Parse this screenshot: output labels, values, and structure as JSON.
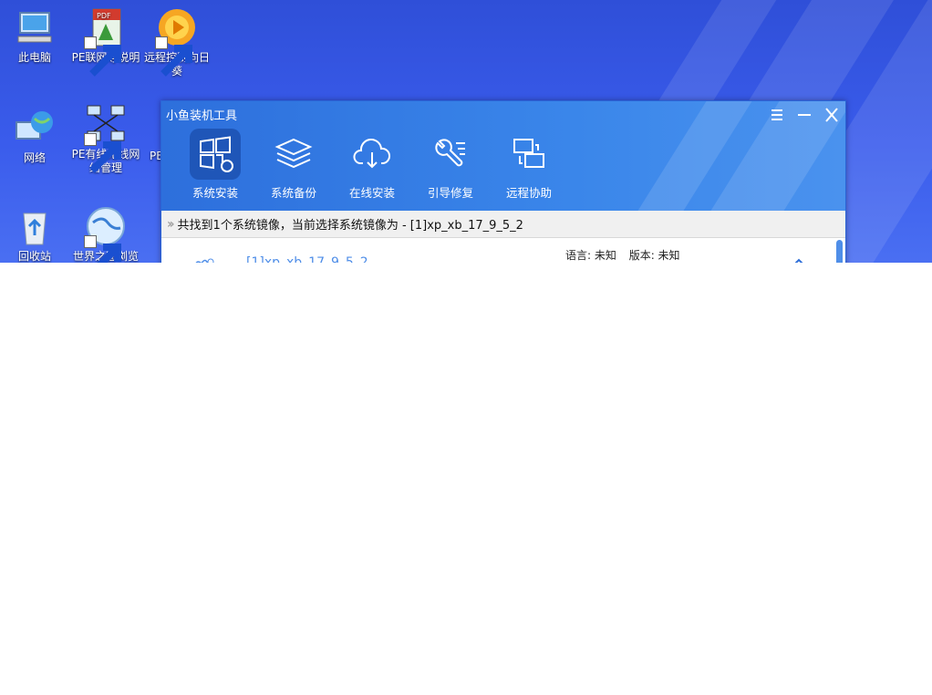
{
  "desktop": {
    "icons": [
      {
        "label": "此电脑",
        "icon": "computer-icon"
      },
      {
        "label": "PE联网等说明",
        "icon": "pdf-document-icon"
      },
      {
        "label": "远程控制向日葵",
        "icon": "sunflower-remote-icon"
      },
      {
        "label": "网络",
        "icon": "network-globe-icon"
      },
      {
        "label": "PE有线无线网络管理",
        "icon": "network-manager-icon"
      },
      {
        "label": "PE",
        "icon": "partial-icon"
      },
      {
        "label": "回收站",
        "icon": "recycle-bin-icon"
      },
      {
        "label": "世界之窗浏览",
        "icon": "browser-globe-icon"
      }
    ]
  },
  "app": {
    "title": "小鱼装机工具",
    "window_controls": [
      "menu-icon",
      "minimize-icon",
      "close-icon"
    ],
    "tools": [
      {
        "label": "系统安装",
        "icon": "windows-reinstall-icon",
        "active": true
      },
      {
        "label": "系统备份",
        "icon": "layers-backup-icon",
        "active": false
      },
      {
        "label": "在线安装",
        "icon": "cloud-download-icon",
        "active": false
      },
      {
        "label": "引导修复",
        "icon": "wrench-repair-icon",
        "active": false
      },
      {
        "label": "远程协助",
        "icon": "remote-screens-icon",
        "active": false
      }
    ],
    "info_text": "共找到1个系统镜像，当前选择系统镜像为 - [1]xp_xb_17_9_5_2",
    "image_list": [
      {
        "name": "[1]xp_xb_17_9_5_2",
        "language_label": "语言: 未知",
        "version_label": "版本: 未知"
      }
    ]
  },
  "colors": {
    "desktop_bg": "#3a5cec",
    "header_bg": "#2d6fdc",
    "active_tool_bg": "#1f56b8",
    "link_blue": "#4f8ee8"
  }
}
